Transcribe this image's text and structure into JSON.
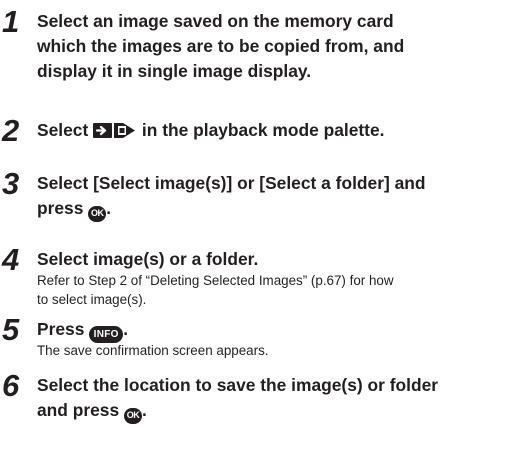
{
  "steps": [
    {
      "num": "1",
      "lines": [
        "Select an image saved on the memory card",
        "which the images are to be copied from, and",
        "display it in single image display."
      ]
    },
    {
      "num": "2",
      "pre": "Select ",
      "post": " in the playback mode palette.",
      "icon": "copy-image-icon"
    },
    {
      "num": "3",
      "line1": "Select [Select image(s)] or [Select a folder] and",
      "line2_pre": "press ",
      "line2_post": ".",
      "icon": "ok-button-icon",
      "icon_text": "OK"
    },
    {
      "num": "4",
      "head": "Select image(s) or a folder.",
      "desc": [
        "Refer to Step 2 of “Deleting Selected Images” (p.67) for how",
        "to select image(s)."
      ]
    },
    {
      "num": "5",
      "pre": "Press ",
      "post": ".",
      "icon": "info-button-icon",
      "icon_text": "INFO",
      "desc": "The save confirmation screen appears."
    },
    {
      "num": "6",
      "line1": "Select the location to save the image(s) or folder",
      "line2_pre": "and press ",
      "line2_post": ".",
      "icon": "ok-button-icon",
      "icon_text": "OK"
    }
  ]
}
